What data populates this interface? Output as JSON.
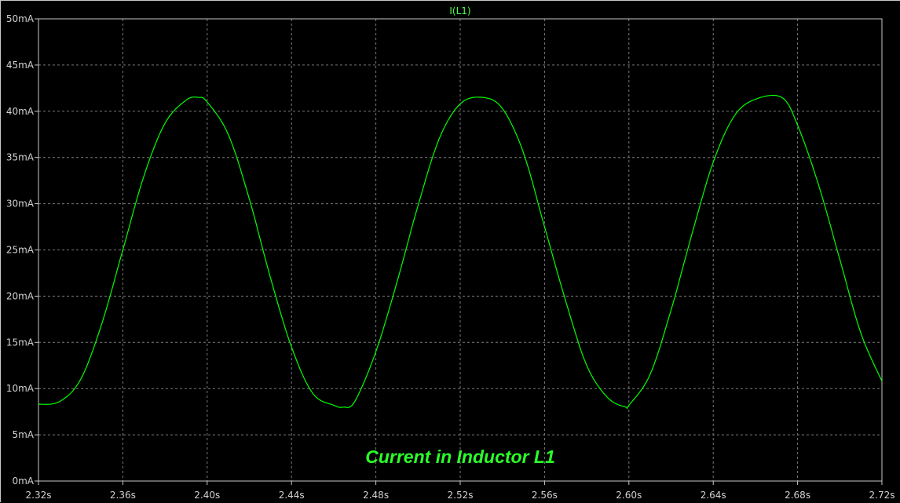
{
  "chart_data": {
    "type": "line",
    "title": "I(L1)",
    "annotation": "Current in Inductor L1",
    "xlim": [
      2.32,
      2.72
    ],
    "ylim": [
      0,
      50
    ],
    "x_ticks": [
      "2.32s",
      "2.36s",
      "2.40s",
      "2.44s",
      "2.48s",
      "2.52s",
      "2.56s",
      "2.60s",
      "2.64s",
      "2.68s",
      "2.72s"
    ],
    "y_ticks": [
      "0mA",
      "5mA",
      "10mA",
      "15mA",
      "20mA",
      "25mA",
      "30mA",
      "35mA",
      "40mA",
      "45mA",
      "50mA"
    ],
    "grid": true,
    "series": [
      {
        "name": "I(L1)",
        "color": "#00ff00",
        "x": [
          2.32,
          2.33,
          2.34,
          2.35,
          2.36,
          2.37,
          2.38,
          2.39,
          2.396,
          2.4,
          2.41,
          2.42,
          2.43,
          2.44,
          2.45,
          2.46,
          2.4645,
          2.47,
          2.48,
          2.49,
          2.5,
          2.51,
          2.52,
          2.5305,
          2.54,
          2.55,
          2.56,
          2.57,
          2.58,
          2.59,
          2.5985,
          2.6,
          2.61,
          2.62,
          2.63,
          2.64,
          2.65,
          2.66,
          2.6725,
          2.68,
          2.69,
          2.7,
          2.71,
          2.72
        ],
        "y": [
          8.3,
          8.6,
          11.0,
          17.0,
          25.0,
          33.0,
          38.7,
          41.2,
          41.5,
          41.0,
          37.5,
          30.5,
          22.0,
          14.5,
          9.5,
          8.2,
          8.0,
          8.6,
          14.0,
          21.5,
          29.8,
          37.0,
          40.8,
          41.5,
          40.3,
          35.5,
          27.5,
          19.5,
          12.5,
          9.0,
          8.0,
          8.2,
          11.5,
          18.5,
          26.8,
          34.5,
          39.5,
          41.3,
          41.5,
          38.5,
          32.0,
          24.0,
          16.0,
          10.8
        ]
      }
    ]
  }
}
